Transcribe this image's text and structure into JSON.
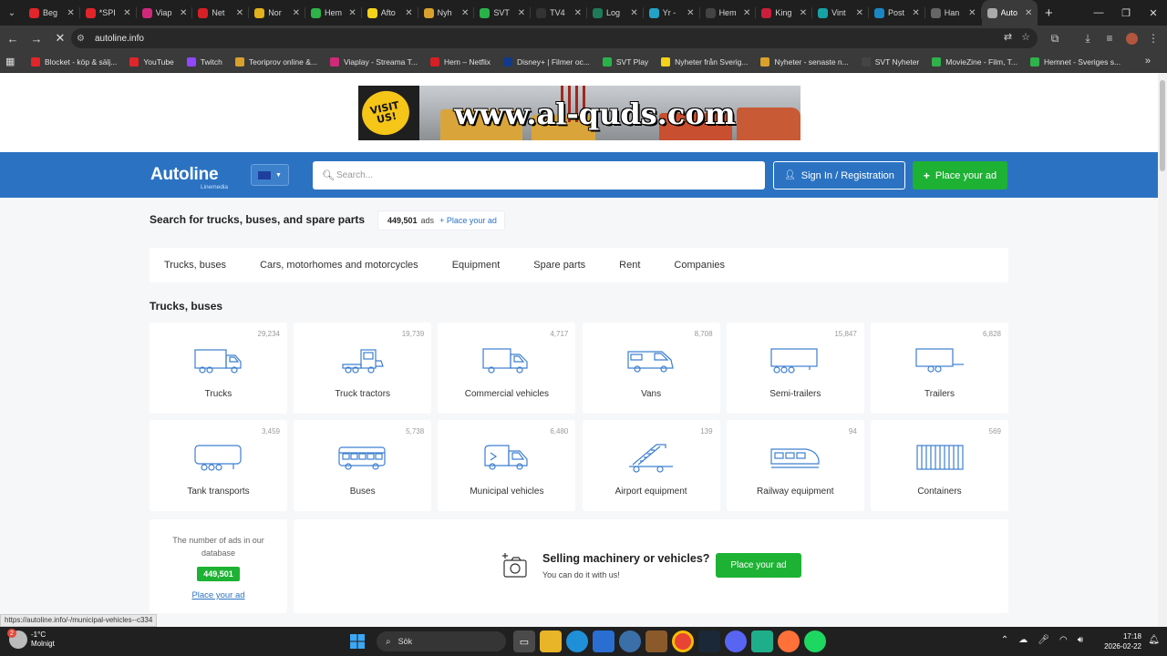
{
  "browser": {
    "tabs": [
      {
        "label": "Beg",
        "color": "#e1252a"
      },
      {
        "label": "*SPI",
        "color": "#e1252a"
      },
      {
        "label": "Viap",
        "color": "#cf2a7a"
      },
      {
        "label": "Net",
        "color": "#d81f26"
      },
      {
        "label": "Nor",
        "color": "#e0b21c"
      },
      {
        "label": "Hem",
        "color": "#2fb24a"
      },
      {
        "label": "Afto",
        "color": "#f4d21a"
      },
      {
        "label": "Nyh",
        "color": "#d8a12c"
      },
      {
        "label": "SVT",
        "color": "#2ab24a"
      },
      {
        "label": "TV4",
        "color": "#333333"
      },
      {
        "label": "Log",
        "color": "#1e7b5a"
      },
      {
        "label": "Yr -",
        "color": "#22a2c6"
      },
      {
        "label": "Hem",
        "color": "#444444"
      },
      {
        "label": "King",
        "color": "#c91f3c"
      },
      {
        "label": "Vint",
        "color": "#17a3a6"
      },
      {
        "label": "Post",
        "color": "#1b86c4"
      },
      {
        "label": "Han",
        "color": "#666666"
      },
      {
        "label": "Auto",
        "color": "#aaaaaa"
      }
    ],
    "close_glyph": "✕",
    "new_tab_glyph": "+",
    "url": "autoline.info",
    "bookmarks": [
      {
        "label": "Blocket - köp & sälj...",
        "color": "#e1252a"
      },
      {
        "label": "YouTube",
        "color": "#e1252a"
      },
      {
        "label": "Twitch",
        "color": "#9146ff"
      },
      {
        "label": "Teoriprov online &...",
        "color": "#d8a12c"
      },
      {
        "label": "Viaplay - Streama T...",
        "color": "#cf2a7a"
      },
      {
        "label": "Hem – Netflix",
        "color": "#d81f26"
      },
      {
        "label": "Disney+ | Filmer oc...",
        "color": "#113a8c"
      },
      {
        "label": "SVT Play",
        "color": "#2ab24a"
      },
      {
        "label": "Nyheter från Sverig...",
        "color": "#f4d21a"
      },
      {
        "label": "Nyheter - senaste n...",
        "color": "#d8a12c"
      },
      {
        "label": "SVT Nyheter",
        "color": "#444444"
      },
      {
        "label": "MovieZine - Film, T...",
        "color": "#2fb24a"
      },
      {
        "label": "Hemnet - Sveriges s...",
        "color": "#2fb24a"
      }
    ],
    "status_url": "https://autoline.info/-/municipal-vehicles--c334"
  },
  "banner": {
    "visit_text": "VISIT US!",
    "url_text": "www.al-quds.com"
  },
  "header": {
    "logo": "Autoline",
    "logo_sub": "Linemedia",
    "search_placeholder": "Search...",
    "signin_label": "Sign In / Registration",
    "place_ad_label": "Place your ad"
  },
  "intro": {
    "title": "Search for trucks, buses, and spare parts",
    "ads_count": "449,501",
    "ads_label": "ads",
    "place_ad_link": "+ Place your ad"
  },
  "category_tabs": [
    "Trucks, buses",
    "Cars, motorhomes and motorcycles",
    "Equipment",
    "Spare parts",
    "Rent",
    "Companies"
  ],
  "section": {
    "title": "Trucks, buses",
    "tiles": [
      {
        "label": "Trucks",
        "count": "29,234",
        "icon": "truck-icon"
      },
      {
        "label": "Truck tractors",
        "count": "19,739",
        "icon": "truck-tractor-icon"
      },
      {
        "label": "Commercial vehicles",
        "count": "4,717",
        "icon": "commercial-vehicle-icon"
      },
      {
        "label": "Vans",
        "count": "8,708",
        "icon": "van-icon"
      },
      {
        "label": "Semi-trailers",
        "count": "15,847",
        "icon": "semi-trailer-icon"
      },
      {
        "label": "Trailers",
        "count": "6,828",
        "icon": "trailer-icon"
      },
      {
        "label": "Tank transports",
        "count": "3,459",
        "icon": "tank-icon"
      },
      {
        "label": "Buses",
        "count": "5,738",
        "icon": "bus-icon"
      },
      {
        "label": "Municipal vehicles",
        "count": "6,480",
        "icon": "municipal-vehicle-icon"
      },
      {
        "label": "Airport equipment",
        "count": "139",
        "icon": "airport-stairs-icon"
      },
      {
        "label": "Railway equipment",
        "count": "94",
        "icon": "train-icon"
      },
      {
        "label": "Containers",
        "count": "569",
        "icon": "container-icon"
      }
    ]
  },
  "counter": {
    "text": "The number of ads in our database",
    "value": "449,501",
    "link": "Place your ad"
  },
  "sell": {
    "title": "Selling machinery or vehicles?",
    "subtitle": "You can do it with us!",
    "button": "Place your ad"
  },
  "taskbar": {
    "notification_count": "2",
    "temperature": "-1°C",
    "weather": "Molnigt",
    "search_label": "Sök",
    "time": "17:18",
    "date": "2026-02-22"
  },
  "colors": {
    "brand_blue": "#2b73c2",
    "cta_green": "#1db233",
    "icon_blue": "#3d7fd0"
  }
}
